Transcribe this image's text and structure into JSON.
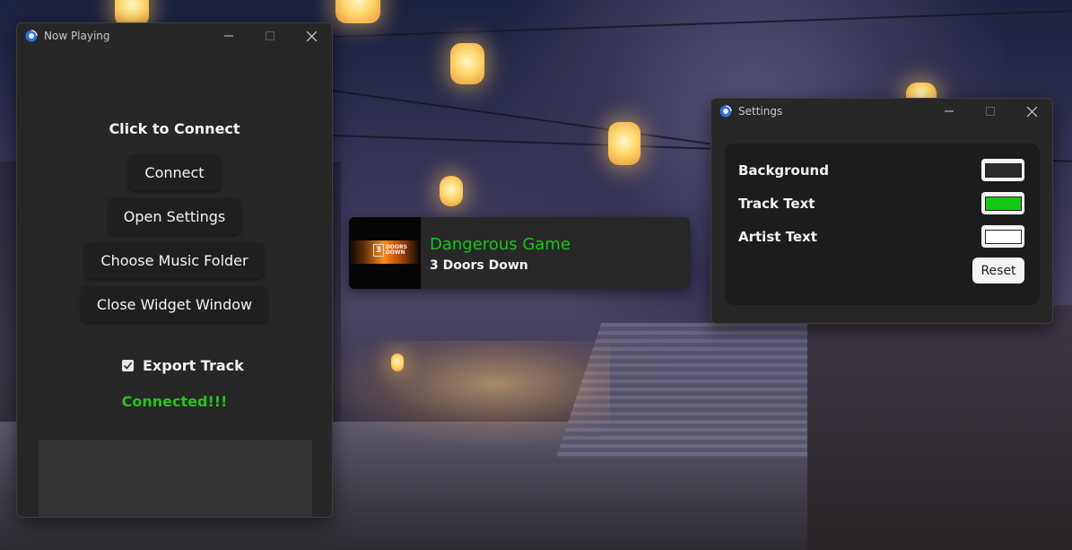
{
  "now_playing_window": {
    "title": "Now Playing",
    "heading": "Click to Connect",
    "buttons": {
      "connect": "Connect",
      "open_settings": "Open Settings",
      "choose_music_folder": "Choose Music Folder",
      "close_widget_window": "Close Widget Window"
    },
    "export_track": {
      "label": "Export Track",
      "checked": true
    },
    "status": "Connected!!!"
  },
  "widget": {
    "track_title": "Dangerous Game",
    "artist": "3 Doors Down",
    "album_logo": {
      "number": "3",
      "text": "DOORS DOWN"
    }
  },
  "settings_window": {
    "title": "Settings",
    "rows": [
      {
        "label": "Background",
        "color": "#2b2b2b"
      },
      {
        "label": "Track Text",
        "color": "#14c814"
      },
      {
        "label": "Artist Text",
        "color": "#ffffff"
      }
    ],
    "reset_label": "Reset"
  },
  "colors": {
    "status_green": "#27c21d",
    "track_green": "#14c814",
    "window_bg": "#272727"
  }
}
